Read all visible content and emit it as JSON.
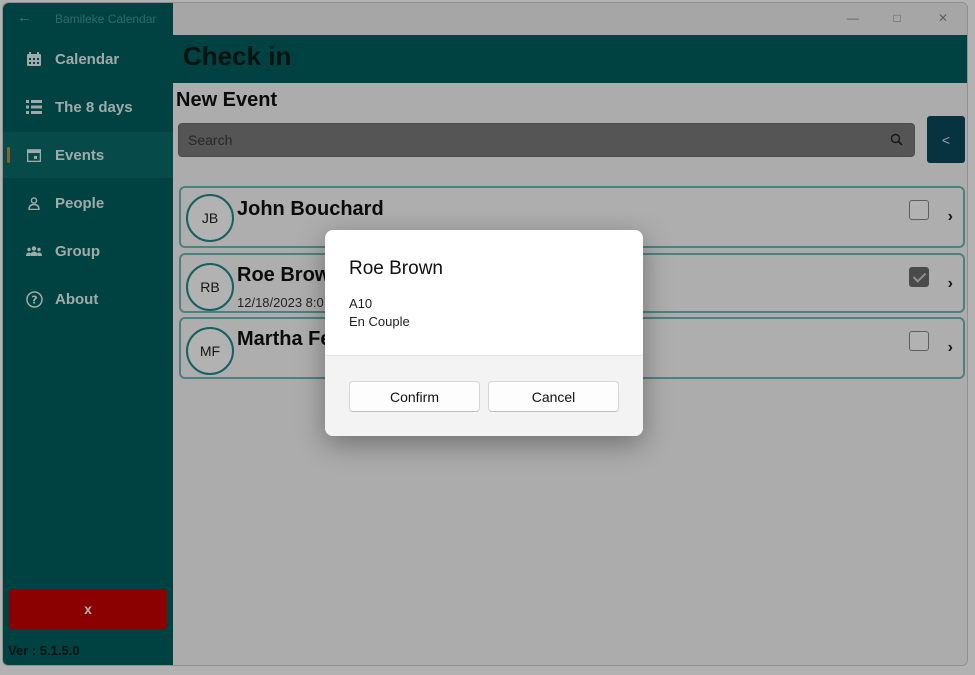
{
  "window": {
    "app_title": "Bamileke Calendar"
  },
  "sidebar": {
    "items": [
      {
        "label": "Calendar",
        "icon": "calendar-icon"
      },
      {
        "label": "The 8 days",
        "icon": "list-icon"
      },
      {
        "label": "Events",
        "icon": "event-icon",
        "active": true
      },
      {
        "label": "People",
        "icon": "person-icon"
      },
      {
        "label": "Group",
        "icon": "group-icon"
      },
      {
        "label": "About",
        "icon": "help-icon"
      }
    ],
    "exit_label": "x",
    "version": "Ver : 5.1.5.0"
  },
  "header": {
    "title": "Check in"
  },
  "main": {
    "subtitle": "New Event",
    "search_placeholder": "Search",
    "collapse_label": "<",
    "people": [
      {
        "initials": "JB",
        "name": "John Bouchard",
        "checked": false
      },
      {
        "initials": "RB",
        "name": "Roe Brow",
        "detail": "12/18/2023 8:0",
        "checked": true
      },
      {
        "initials": "MF",
        "name": "Martha Fe",
        "checked": false
      }
    ]
  },
  "dialog": {
    "title": "Roe Brown",
    "line1": "A10",
    "line2": "En Couple",
    "confirm_label": "Confirm",
    "cancel_label": "Cancel"
  },
  "colors": {
    "accent": "#005e5e",
    "danger": "#c80000",
    "row_border": "#6fb9b9"
  }
}
